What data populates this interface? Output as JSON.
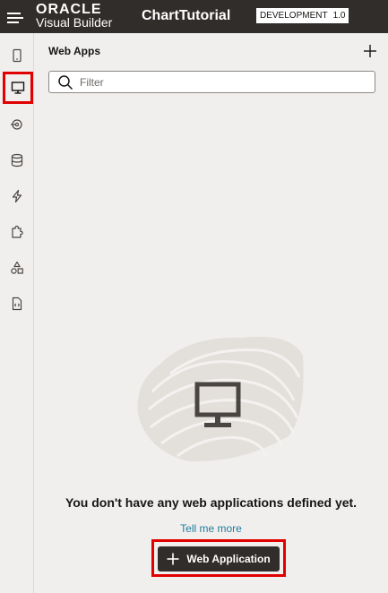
{
  "header": {
    "menu_icon": "hamburger-icon",
    "oracle": "ORACLE",
    "product": "Visual Builder",
    "app_name": "ChartTutorial",
    "environment": "DEVELOPMENT",
    "version": "1.0"
  },
  "rail": {
    "items": [
      {
        "name": "mobile-apps",
        "icon": "mobile-icon",
        "active": false
      },
      {
        "name": "web-apps",
        "icon": "monitor-icon",
        "active": true
      },
      {
        "name": "services",
        "icon": "service-icon",
        "active": false
      },
      {
        "name": "business-objects",
        "icon": "database-icon",
        "active": false
      },
      {
        "name": "processes",
        "icon": "lightning-icon",
        "active": false
      },
      {
        "name": "components",
        "icon": "puzzle-icon",
        "active": false
      },
      {
        "name": "layouts",
        "icon": "shapes-icon",
        "active": false
      },
      {
        "name": "source",
        "icon": "source-file-icon",
        "active": false
      }
    ]
  },
  "panel": {
    "title": "Web Apps",
    "add_icon": "plus-icon",
    "search_placeholder": "Filter",
    "search_value": "",
    "empty_message": "You don't have any web applications defined yet.",
    "tell_me_more": "Tell me more",
    "cta_label": "Web Application"
  },
  "colors": {
    "topbar": "#312d2a",
    "background": "#f1efed",
    "highlight": "#e00000",
    "link": "#227e9e"
  }
}
